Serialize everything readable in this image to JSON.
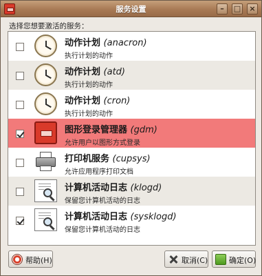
{
  "window": {
    "title": "服务设置",
    "icon": "gdm-app-icon",
    "controls": [
      "minimize-icon",
      "maximize-icon",
      "close-icon"
    ]
  },
  "instruction": "选择您想要激活的服务：",
  "services": [
    {
      "checked": false,
      "name": "动作计划",
      "code": "(anacron)",
      "description": "执行计划的动作",
      "icon": "clock-icon"
    },
    {
      "checked": false,
      "name": "动作计划",
      "code": "(atd)",
      "description": "执行计划的动作",
      "icon": "clock-icon"
    },
    {
      "checked": false,
      "name": "动作计划",
      "code": "(cron)",
      "description": "执行计划的动作",
      "icon": "clock-icon"
    },
    {
      "checked": true,
      "name": "图形登录管理器",
      "code": "(gdm)",
      "description": "允许用户以图形方式登录",
      "icon": "gdm-icon",
      "selected": true
    },
    {
      "checked": false,
      "name": "打印机服务",
      "code": "(cupsys)",
      "description": "允许应用程序打印文档",
      "icon": "printer-icon"
    },
    {
      "checked": false,
      "name": "计算机活动日志",
      "code": "(klogd)",
      "description": "保留您计算机活动的日志",
      "icon": "log-viewer-icon"
    },
    {
      "checked": true,
      "name": "计算机活动日志",
      "code": "(sysklogd)",
      "description": "保留您计算机活动的日志",
      "icon": "log-viewer-icon"
    }
  ],
  "buttons": {
    "help": "帮助(H)",
    "cancel": "取消(C)",
    "ok": "确定(O)"
  },
  "colors": {
    "selection": "#f27a7a",
    "titlebar": "#a87a55"
  }
}
